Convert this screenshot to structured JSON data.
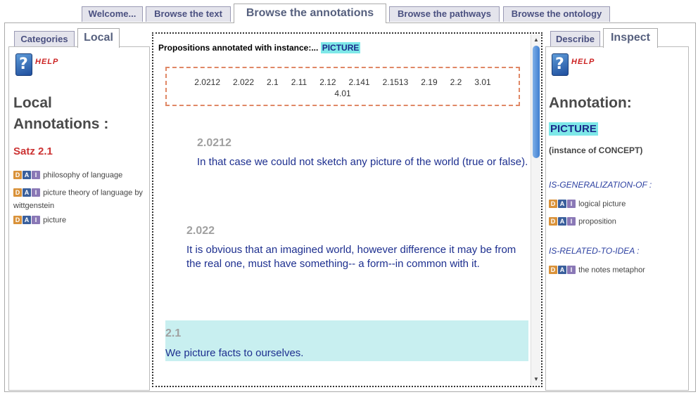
{
  "top_tabs": [
    {
      "label": "Welcome...",
      "active": false
    },
    {
      "label": "Browse the text",
      "active": false
    },
    {
      "label": "Browse the annotations",
      "active": true
    },
    {
      "label": "Browse the pathways",
      "active": false
    },
    {
      "label": "Browse the ontology",
      "active": false
    }
  ],
  "left_panel": {
    "tabs": [
      {
        "label": "Categories"
      },
      {
        "label": "Local"
      }
    ],
    "help_label": "HELP",
    "heading_line1": "Local",
    "heading_line2": "Annotations :",
    "satz": "Satz 2.1",
    "annotations": [
      {
        "label": "philosophy of language"
      },
      {
        "label": "picture theory of language by wittgenstein"
      },
      {
        "label": "picture"
      }
    ]
  },
  "dai_letters": [
    "D",
    "A",
    "I"
  ],
  "center": {
    "header_prefix": "Propositions annotated with instance:...",
    "header_instance": "PICTURE",
    "numbers": [
      "2.0212",
      "2.022",
      "2.1",
      "2.11",
      "2.12",
      "2.141",
      "2.1513",
      "2.19",
      "2.2",
      "3.01",
      "4.01"
    ],
    "propositions": [
      {
        "num": "2.0212",
        "text": "In that case we could not sketch any picture of the world (true or false)."
      },
      {
        "num": "2.022",
        "text": "It is obvious that an imagined world, however difference it may be from the real one, must have something-- a form--in common with it."
      },
      {
        "num": "2.1",
        "text": "We picture facts to ourselves.",
        "selected": true
      }
    ]
  },
  "right_panel": {
    "tabs": [
      {
        "label": "Describe"
      },
      {
        "label": "Inspect"
      }
    ],
    "help_label": "HELP",
    "heading": "Annotation:",
    "instance": "PICTURE",
    "instance_of": "(instance of CONCEPT)",
    "relations": [
      {
        "label": "IS-GENERALIZATION-OF :",
        "items": [
          {
            "label": "logical picture"
          },
          {
            "label": "proposition"
          }
        ]
      },
      {
        "label": "IS-RELATED-TO-IDEA :",
        "items": [
          {
            "label": "the notes metaphor"
          }
        ]
      }
    ]
  },
  "colors": {
    "accent_highlight": "#7ee8e8",
    "proposition_text": "#1d2f8f",
    "satz_red": "#cc3333"
  }
}
